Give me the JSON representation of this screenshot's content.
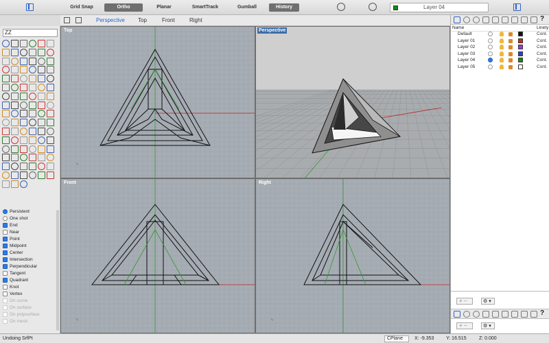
{
  "toolbar": {
    "grid_snap": "Grid Snap",
    "ortho": "Ortho",
    "planar": "Planar",
    "smarttrack": "SmartTrack",
    "gumball": "Gumball",
    "history": "History",
    "active_layer": "Layer 04",
    "active_layer_color": "#138a1d"
  },
  "command": {
    "value": "ZZ"
  },
  "viewport_tabs": [
    "Perspective",
    "Top",
    "Front",
    "Right"
  ],
  "viewports": {
    "top": "Top",
    "perspective": "Perspective",
    "front": "Front",
    "right": "Right"
  },
  "osnap": {
    "persistent": "Persistent",
    "one_shot": "One shot",
    "items": [
      {
        "label": "End",
        "checked": true
      },
      {
        "label": "Near",
        "checked": false
      },
      {
        "label": "Point",
        "checked": true
      },
      {
        "label": "Midpoint",
        "checked": true
      },
      {
        "label": "Center",
        "checked": true
      },
      {
        "label": "Intersection",
        "checked": true
      },
      {
        "label": "Perpendicular",
        "checked": true
      },
      {
        "label": "Tangent",
        "checked": false
      },
      {
        "label": "Quadrant",
        "checked": true
      },
      {
        "label": "Knot",
        "checked": false
      },
      {
        "label": "Vertex",
        "checked": false
      }
    ],
    "disabled": [
      "On curve",
      "On surface",
      "On polysurface",
      "On mesh"
    ]
  },
  "layers": {
    "header_name": "Name",
    "header_linetype": "Linety",
    "rows": [
      {
        "name": "Default",
        "color": "#111111",
        "linetype": "Cont.",
        "current": false
      },
      {
        "name": "Layer 01",
        "color": "#e02020",
        "linetype": "Cont.",
        "current": false
      },
      {
        "name": "Layer 02",
        "color": "#9b3ad6",
        "linetype": "Cont.",
        "current": false
      },
      {
        "name": "Layer 03",
        "color": "#2c3fe0",
        "linetype": "Cont.",
        "current": false
      },
      {
        "name": "Layer 04",
        "color": "#138a1d",
        "linetype": "Cont.",
        "current": true
      },
      {
        "name": "Layer 05",
        "color": "#ffffff",
        "linetype": "Cont.",
        "current": false
      }
    ]
  },
  "status": {
    "message": "Undoing SrfPt",
    "cplane": "CPlane",
    "x": "X: -9.353",
    "y": "Y: 16.515",
    "z": "Z: 0.000"
  }
}
